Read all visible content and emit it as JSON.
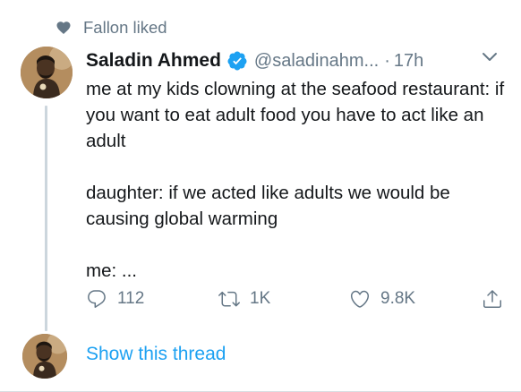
{
  "social_context": {
    "icon": "heart-icon",
    "text": "Fallon liked"
  },
  "tweet": {
    "author": {
      "display_name": "Saladin Ahmed",
      "handle": "@saladinahm...",
      "verified": true
    },
    "separator": "·",
    "timestamp": "17h",
    "text_paragraphs": [
      "me at my kids clowning at the seafood restaurant: if you want to eat adult food you have to act like an adult",
      "daughter: if we acted like adults we would be causing global warming",
      "me: ..."
    ],
    "actions": {
      "reply_count": "112",
      "retweet_count": "1K",
      "like_count": "9.8K"
    }
  },
  "thread": {
    "link_text": "Show this thread"
  },
  "colors": {
    "accent": "#1da1f2",
    "secondary_text": "#657786",
    "primary_text": "#14171a",
    "thread_line": "#ccd6dd"
  }
}
